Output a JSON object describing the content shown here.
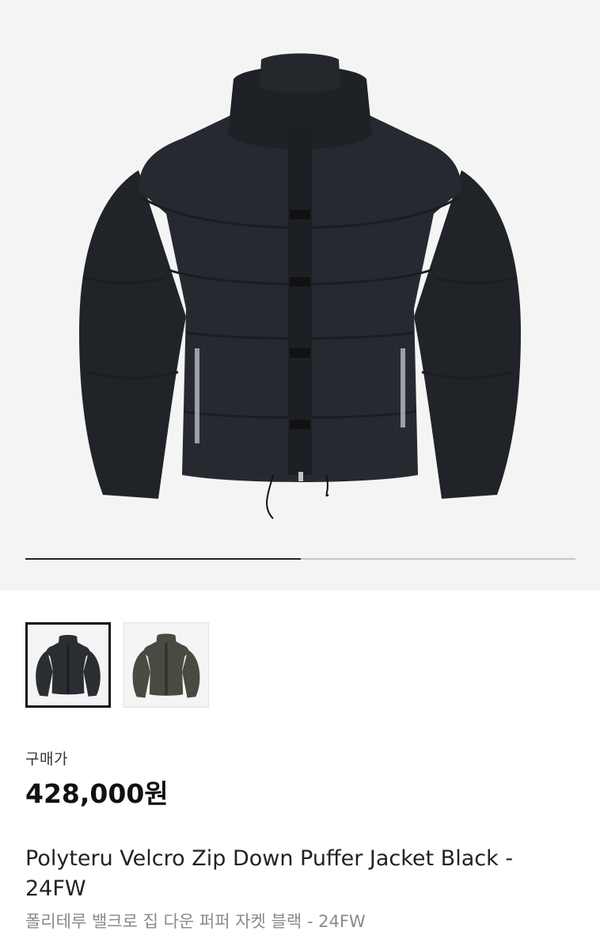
{
  "product": {
    "name": "Polyteru Velcro Zip Down Puffer Jacket Black - 24FW",
    "name_kr": "폴리테루 밸크로 집 다운 퍼퍼 자켓 블랙 - 24FW",
    "price_label": "구매가",
    "price": "428,000원"
  },
  "gallery": {
    "progress": 0.5,
    "thumbnails": [
      {
        "name": "thumbnail-black",
        "color": "#2a2e33",
        "selected": true
      },
      {
        "name": "thumbnail-olive",
        "color": "#4a4a42",
        "selected": false
      }
    ]
  },
  "colors": {
    "hero_bg": "#f4f4f4",
    "jacket_black": "#24282d",
    "jacket_olive": "#4a4a42"
  }
}
